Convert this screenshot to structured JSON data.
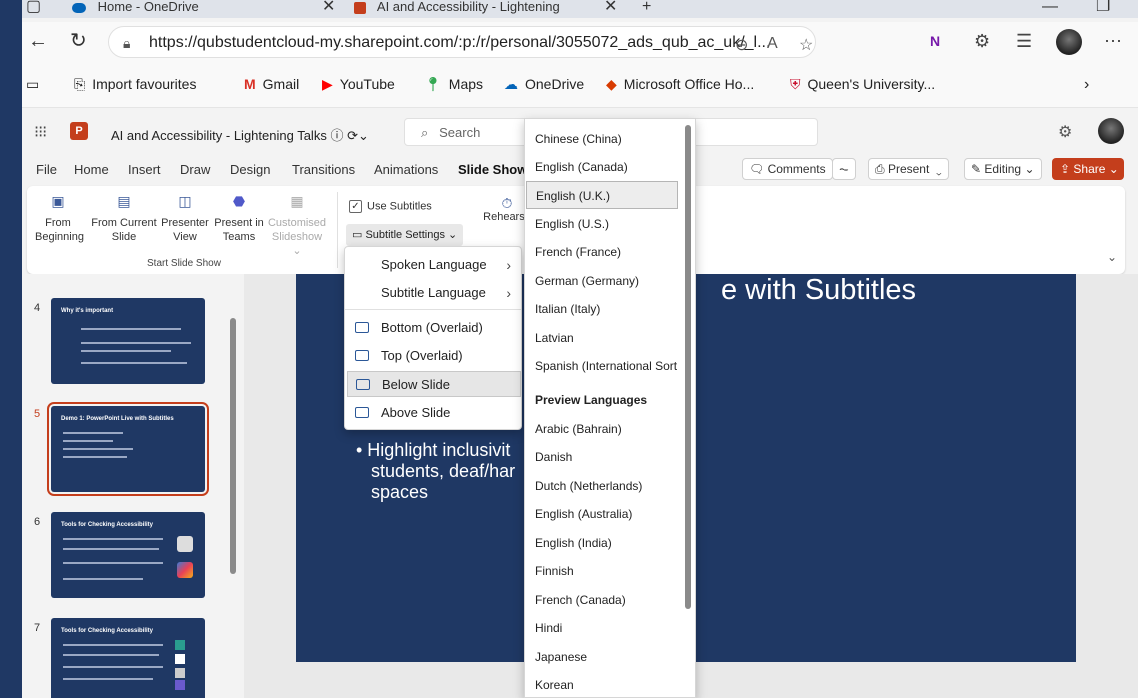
{
  "browser": {
    "tabs": [
      {
        "title": "Home - OneDrive",
        "icon": "onedrive-icon",
        "color": "#0364b8"
      },
      {
        "title": "AI and Accessibility - Lightening",
        "icon": "powerpoint-icon",
        "color": "#c43e1c"
      }
    ],
    "url": "https://qubstudentcloud-my.sharepoint.com/:p:/r/personal/3055072_ads_qub_ac_uk/_l...",
    "favourites": [
      {
        "label": "Import favourites",
        "icon": "import-favourites-icon"
      },
      {
        "label": "Gmail",
        "icon": "gmail-icon"
      },
      {
        "label": "YouTube",
        "icon": "youtube-icon"
      },
      {
        "label": "Maps",
        "icon": "maps-icon"
      },
      {
        "label": "OneDrive",
        "icon": "onedrive-icon"
      },
      {
        "label": "Microsoft Office Ho...",
        "icon": "office-icon"
      },
      {
        "label": "Queen's University...",
        "icon": "queens-university-icon"
      }
    ]
  },
  "app": {
    "app_logo_letter": "P",
    "doc_title": "AI and Accessibility  - Lightening Talks",
    "search_placeholder": "Search",
    "accent": "#c43e1c"
  },
  "menu": {
    "items": [
      "File",
      "Home",
      "Insert",
      "Draw",
      "Design",
      "Transitions",
      "Animations",
      "Slide Show"
    ],
    "active": "Slide Show",
    "comments": "Comments",
    "present": "Present",
    "editing": "Editing",
    "share": "Share"
  },
  "ribbon": {
    "buttons": [
      {
        "label": "From\nBeginning",
        "icon": "present-from-beginning-icon"
      },
      {
        "label": "From Current\nSlide",
        "icon": "present-from-current-icon"
      },
      {
        "label": "Presenter\nView",
        "icon": "presenter-view-icon"
      },
      {
        "label": "Present in\nTeams",
        "icon": "teams-icon"
      },
      {
        "label": "Customised\nSlideshow",
        "icon": "custom-slideshow-icon"
      }
    ],
    "group_label": "Start Slide Show",
    "use_subtitles": "Use Subtitles",
    "subtitle_settings": "Subtitle Settings",
    "rehearse": "Rehearse"
  },
  "thumbnails": [
    {
      "num": "4",
      "title": "Why it's important"
    },
    {
      "num": "5",
      "title": "Demo 1: PowerPoint Live with Subtitles",
      "selected": true
    },
    {
      "num": "6",
      "title": "Tools for Checking Accessibility"
    },
    {
      "num": "7",
      "title": "Tools for Checking Accessibility"
    }
  ],
  "slide": {
    "title_fragment": "e with Subtitles",
    "bullet": "• Highlight inclusivit",
    "bullet_line2": "students, deaf/har",
    "bullet_line3": "spaces"
  },
  "subtitle_menu": {
    "items": [
      {
        "label": "Spoken Language",
        "has_arrow": true
      },
      {
        "label": "Subtitle Language",
        "has_arrow": true
      },
      {
        "label": "Bottom (Overlaid)"
      },
      {
        "label": "Top (Overlaid)"
      },
      {
        "label": "Below Slide",
        "highlighted": true
      },
      {
        "label": "Above Slide"
      }
    ]
  },
  "languages": {
    "items": [
      "Chinese (China)",
      "English (Canada)",
      "English (U.K.)",
      "English (U.S.)",
      "French (France)",
      "German (Germany)",
      "Italian (Italy)",
      "Latvian",
      "Spanish (International Sort"
    ],
    "selected": "English (U.K.)",
    "preview_header": "Preview Languages",
    "preview_items": [
      "Arabic (Bahrain)",
      "Danish",
      "Dutch (Netherlands)",
      "English (Australia)",
      "English (India)",
      "Finnish",
      "French (Canada)",
      "Hindi",
      "Japanese",
      "Korean"
    ]
  }
}
